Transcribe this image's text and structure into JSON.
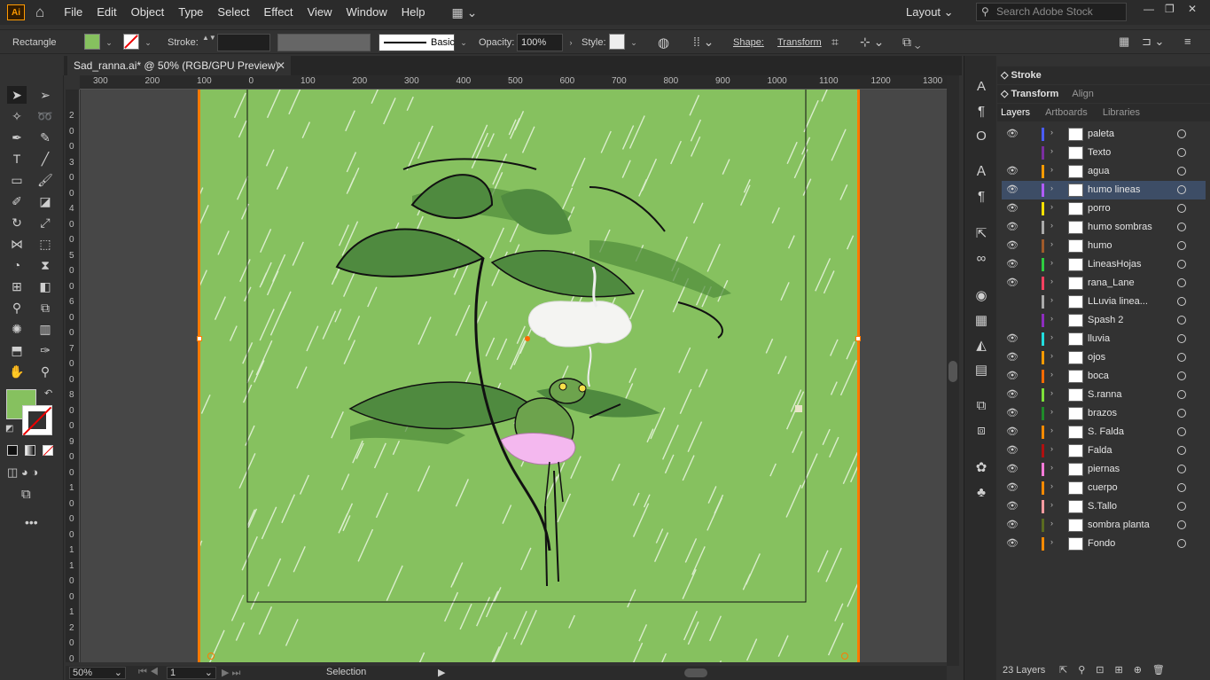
{
  "app": {
    "logo": "Ai",
    "workspace": "Layout",
    "search_placeholder": "Search Adobe Stock"
  },
  "menu": [
    "File",
    "Edit",
    "Object",
    "Type",
    "Select",
    "Effect",
    "View",
    "Window",
    "Help"
  ],
  "control": {
    "tool_name": "Rectangle",
    "fill_color": "#86c15f",
    "stroke_label": "Stroke:",
    "stroke_style": "Basic",
    "opacity_label": "Opacity:",
    "opacity_value": "100%",
    "style_label": "Style:",
    "shape_label": "Shape:",
    "transform_label": "Transform"
  },
  "document": {
    "tab_title": "Sad_ranna.ai* @ 50% (RGB/GPU Preview)",
    "close": "✕"
  },
  "ruler": {
    "top": [
      "300",
      "200",
      "100",
      "0",
      "100",
      "200",
      "300",
      "400",
      "500",
      "600",
      "700",
      "800",
      "900",
      "1000",
      "1100",
      "1200",
      "1300"
    ],
    "left": [
      "2",
      "0",
      "0",
      "3",
      "0",
      "0",
      "4",
      "0",
      "0",
      "5",
      "0",
      "0",
      "6",
      "0",
      "0",
      "7",
      "0",
      "0",
      "8",
      "0",
      "0",
      "9",
      "0",
      "0",
      "1",
      "0",
      "0",
      "0",
      "1",
      "1",
      "0",
      "0",
      "1",
      "2",
      "0",
      "0"
    ]
  },
  "status": {
    "zoom": "50%",
    "artboard_num": "1",
    "tool": "Selection"
  },
  "panels": {
    "stroke": "Stroke",
    "transform": "Transform",
    "align": "Align",
    "tabs": [
      "Layers",
      "Artboards",
      "Libraries"
    ],
    "layer_count": "23 Layers"
  },
  "layers": [
    {
      "name": "paleta",
      "color": "#4a5cff",
      "visible": true,
      "selected": false
    },
    {
      "name": "Texto",
      "color": "#7a2ea0",
      "visible": false,
      "selected": false
    },
    {
      "name": "agua",
      "color": "#ff9a00",
      "visible": true,
      "selected": false
    },
    {
      "name": "humo lineas",
      "color": "#b05cff",
      "visible": true,
      "selected": true
    },
    {
      "name": "porro",
      "color": "#ffe100",
      "visible": true,
      "selected": false
    },
    {
      "name": "humo sombras",
      "color": "#aaaaaa",
      "visible": true,
      "selected": false
    },
    {
      "name": "humo",
      "color": "#a05a2a",
      "visible": true,
      "selected": false
    },
    {
      "name": "LineasHojas",
      "color": "#2ecc40",
      "visible": true,
      "selected": false
    },
    {
      "name": "rana_Lane",
      "color": "#ff4060",
      "visible": true,
      "selected": false
    },
    {
      "name": "LLuvia linea...",
      "color": "#aaaaaa",
      "visible": false,
      "selected": false
    },
    {
      "name": "Spash 2",
      "color": "#8e2cbf",
      "visible": false,
      "selected": false
    },
    {
      "name": "lluvia",
      "color": "#22dddd",
      "visible": true,
      "selected": false
    },
    {
      "name": "ojos",
      "color": "#ff9a00",
      "visible": true,
      "selected": false
    },
    {
      "name": "boca",
      "color": "#ff6a00",
      "visible": true,
      "selected": false
    },
    {
      "name": "S.ranna",
      "color": "#7ddf3a",
      "visible": true,
      "selected": false
    },
    {
      "name": "brazos",
      "color": "#1f8a2a",
      "visible": true,
      "selected": false
    },
    {
      "name": "S. Falda",
      "color": "#ff8a00",
      "visible": true,
      "selected": false
    },
    {
      "name": "Falda",
      "color": "#b01010",
      "visible": true,
      "selected": false
    },
    {
      "name": "piernas",
      "color": "#ff7ad9",
      "visible": true,
      "selected": false
    },
    {
      "name": "cuerpo",
      "color": "#ff8a00",
      "visible": true,
      "selected": false
    },
    {
      "name": "S.Tallo",
      "color": "#ff9aa0",
      "visible": true,
      "selected": false
    },
    {
      "name": "sombra planta",
      "color": "#5a6b20",
      "visible": true,
      "selected": false
    },
    {
      "name": "Fondo",
      "color": "#ff8a00",
      "visible": true,
      "selected": false
    }
  ]
}
